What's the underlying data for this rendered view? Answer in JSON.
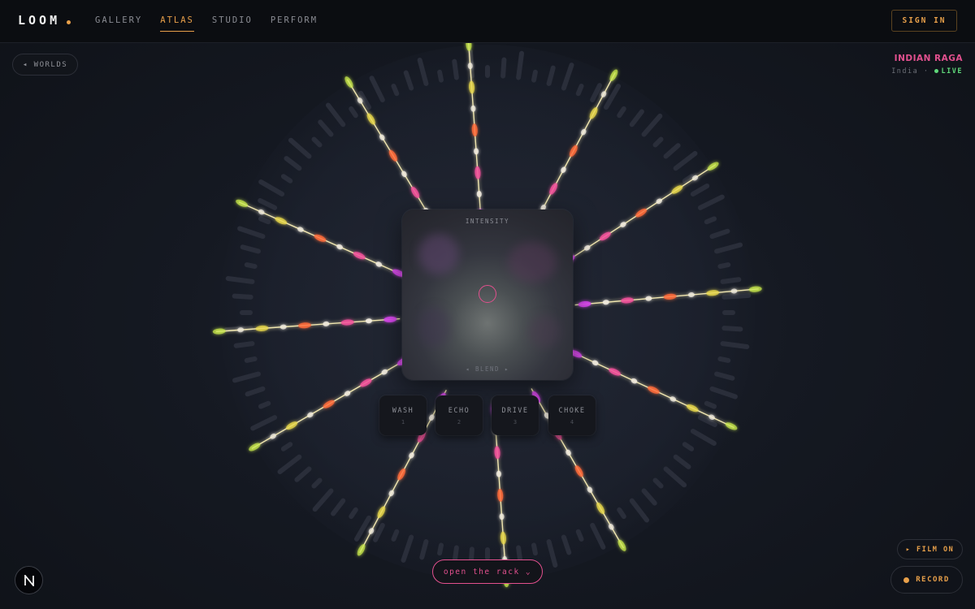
{
  "header": {
    "logo": "LOOM",
    "nav": [
      {
        "label": "GALLERY",
        "active": false
      },
      {
        "label": "ATLAS",
        "active": true
      },
      {
        "label": "STUDIO",
        "active": false
      },
      {
        "label": "PERFORM",
        "active": false
      }
    ],
    "sign_in": "SIGN IN"
  },
  "worlds_button": "◂ WORLDS",
  "world": {
    "title": "INDIAN RAGA",
    "region": "India ·",
    "status": "LIVE"
  },
  "pad": {
    "title": "INTENSITY",
    "footer": "◂ BLEND ▸"
  },
  "effects": [
    {
      "label": "WASH",
      "key": "1"
    },
    {
      "label": "ECHO",
      "key": "2"
    },
    {
      "label": "DRIVE",
      "key": "3"
    },
    {
      "label": "CHOKE",
      "key": "4"
    }
  ],
  "rack_button": "open the rack ⌄",
  "film_button": "▸ FILM ON",
  "record_button": "RECORD",
  "colors": {
    "accent": "#e8a04a",
    "pink": "#e2508e",
    "live": "#5fd87a",
    "magenta": "#d946ef",
    "yellow": "#e8d84a",
    "cyan": "#5fe0f0"
  },
  "icons": {
    "logo_dot": "dot-icon",
    "badge": "n-logo-icon",
    "record": "record-dot-icon",
    "live": "live-dot-icon"
  },
  "spokes": {
    "count": 12,
    "angles_deg": [
      -94,
      -62,
      -33,
      -5,
      25,
      60,
      86,
      118,
      150,
      176,
      204,
      239
    ]
  }
}
